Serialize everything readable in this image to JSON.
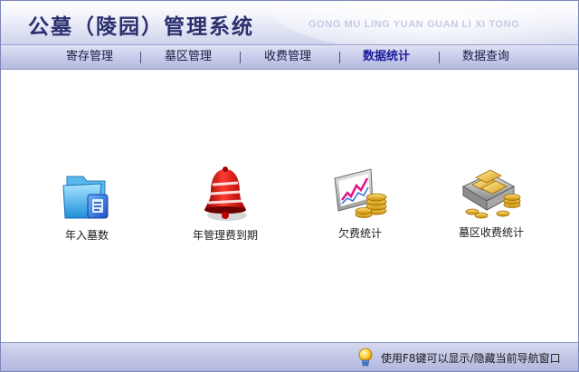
{
  "header": {
    "title": "公墓（陵园）管理系统",
    "subtitle": "GONG MU LING YUAN GUAN LI XI TONG"
  },
  "nav": {
    "items": [
      {
        "label": "寄存管理",
        "active": false
      },
      {
        "label": "墓区管理",
        "active": false
      },
      {
        "label": "收费管理",
        "active": false
      },
      {
        "label": "数据统计",
        "active": true
      },
      {
        "label": "数据查询",
        "active": false
      }
    ]
  },
  "main": {
    "modules": [
      {
        "label": "年入墓数",
        "icon": "folder-document-icon"
      },
      {
        "label": "年管理费到期",
        "icon": "alarm-bell-icon"
      },
      {
        "label": "欠费统计",
        "icon": "chart-coins-icon"
      },
      {
        "label": "墓区收费统计",
        "icon": "gold-bars-coins-icon"
      }
    ]
  },
  "status": {
    "text": "使用F8键可以显示/隐藏当前导航窗口",
    "icon": "lightbulb-icon"
  },
  "colors": {
    "title": "#2a2f6e",
    "nav_active": "#1a1a9c",
    "border": "#7d86b8"
  }
}
